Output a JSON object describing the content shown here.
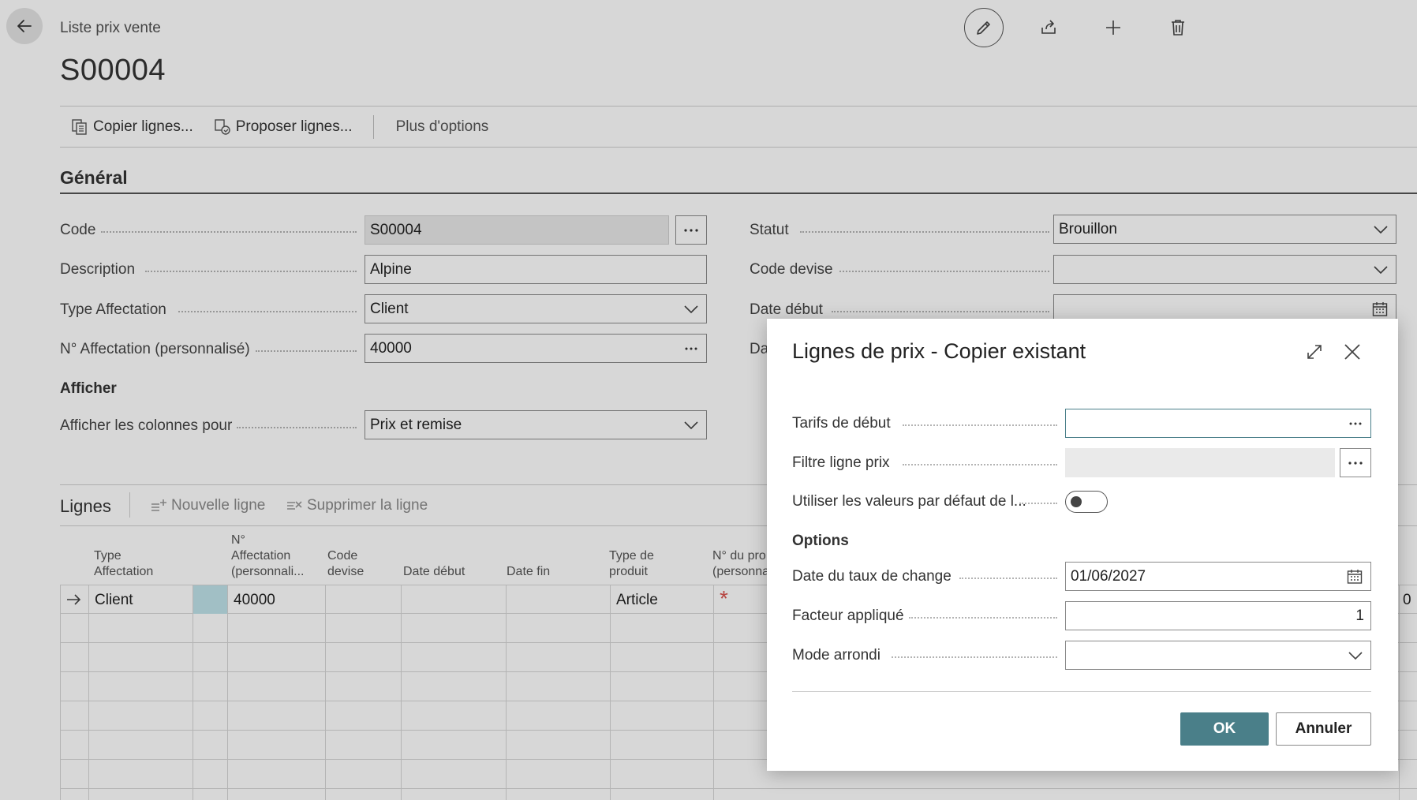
{
  "header": {
    "breadcrumb": "Liste prix vente",
    "title": "S00004"
  },
  "actions": {
    "copy_lines": "Copier lignes...",
    "suggest_lines": "Proposer lignes...",
    "more_options": "Plus d'options"
  },
  "general": {
    "section_title": "Général",
    "code_label": "Code",
    "code_value": "S00004",
    "description_label": "Description",
    "description_value": "Alpine",
    "assign_type_label": "Type Affectation",
    "assign_type_value": "Client",
    "assign_no_label": "N° Affectation (personnalisé)",
    "assign_no_value": "40000",
    "show_subhead": "Afficher",
    "show_columns_label": "Afficher les colonnes pour",
    "show_columns_value": "Prix et remise",
    "status_label": "Statut",
    "status_value": "Brouillon",
    "currency_label": "Code devise",
    "currency_value": "",
    "start_date_label": "Date début",
    "start_date_value": "",
    "partial_label": "Da"
  },
  "lines": {
    "title": "Lignes",
    "new_line": "Nouvelle ligne",
    "delete_line": "Supprimer la ligne",
    "columns": [
      "Type\nAffectation",
      "N°\nAffectation\n(personnali...",
      "Code\ndevise",
      "Date début",
      "Date fin",
      "Type de\nproduit",
      "N° du pro\n(personna"
    ],
    "row1": {
      "assign_type": "Client",
      "assign_no": "40000",
      "product_type": "Article",
      "required_mark": "*",
      "trailing_digit": "0"
    }
  },
  "dialog": {
    "title": "Lignes de prix - Copier existant",
    "start_tariffs_label": "Tarifs de début",
    "start_tariffs_value": "",
    "price_filter_label": "Filtre ligne prix",
    "price_filter_value": "",
    "use_defaults_label": "Utiliser les valeurs par défaut de l...",
    "options_subhead": "Options",
    "exchange_date_label": "Date du taux de change",
    "exchange_date_value": "01/06/2027",
    "factor_label": "Facteur appliqué",
    "factor_value": "1",
    "rounding_label": "Mode arrondi",
    "rounding_value": "",
    "ok_label": "OK",
    "cancel_label": "Annuler"
  }
}
